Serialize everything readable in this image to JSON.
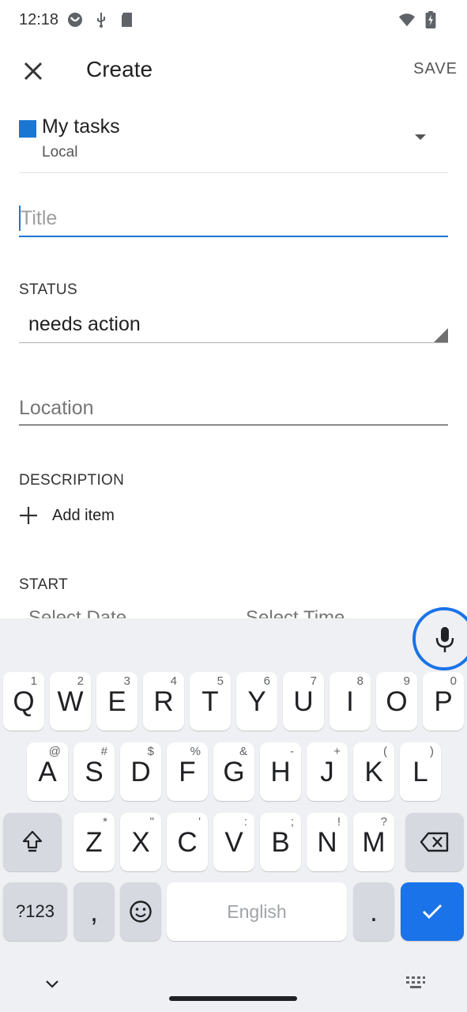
{
  "status_bar": {
    "time": "12:18"
  },
  "app_bar": {
    "title": "Create",
    "save_label": "SAVE"
  },
  "task_list": {
    "name": "My tasks",
    "account": "Local",
    "color": "#1976d2"
  },
  "title_field": {
    "placeholder": "Title"
  },
  "status": {
    "label": "STATUS",
    "value": "needs action"
  },
  "location_field": {
    "placeholder": "Location"
  },
  "description": {
    "label": "DESCRIPTION",
    "add_item_label": "Add item"
  },
  "start": {
    "label": "START",
    "date_placeholder": "Select Date",
    "time_placeholder": "Select Time"
  },
  "keyboard": {
    "row1": [
      {
        "main": "Q",
        "hint": "1"
      },
      {
        "main": "W",
        "hint": "2"
      },
      {
        "main": "E",
        "hint": "3"
      },
      {
        "main": "R",
        "hint": "4"
      },
      {
        "main": "T",
        "hint": "5"
      },
      {
        "main": "Y",
        "hint": "6"
      },
      {
        "main": "U",
        "hint": "7"
      },
      {
        "main": "I",
        "hint": "8"
      },
      {
        "main": "O",
        "hint": "9"
      },
      {
        "main": "P",
        "hint": "0"
      }
    ],
    "row2": [
      {
        "main": "A",
        "hint": "@"
      },
      {
        "main": "S",
        "hint": "#"
      },
      {
        "main": "D",
        "hint": "$"
      },
      {
        "main": "F",
        "hint": "%"
      },
      {
        "main": "G",
        "hint": "&"
      },
      {
        "main": "H",
        "hint": "-"
      },
      {
        "main": "J",
        "hint": "+"
      },
      {
        "main": "K",
        "hint": "("
      },
      {
        "main": "L",
        "hint": ")"
      }
    ],
    "row3": [
      {
        "main": "Z",
        "hint": "*"
      },
      {
        "main": "X",
        "hint": "\""
      },
      {
        "main": "C",
        "hint": "'"
      },
      {
        "main": "V",
        "hint": ":"
      },
      {
        "main": "B",
        "hint": ";"
      },
      {
        "main": "N",
        "hint": "!"
      },
      {
        "main": "M",
        "hint": "?"
      }
    ],
    "symbols_label": "?123",
    "comma_label": ",",
    "space_label": "English",
    "period_label": ".",
    "accent_color": "#1a73e8"
  }
}
